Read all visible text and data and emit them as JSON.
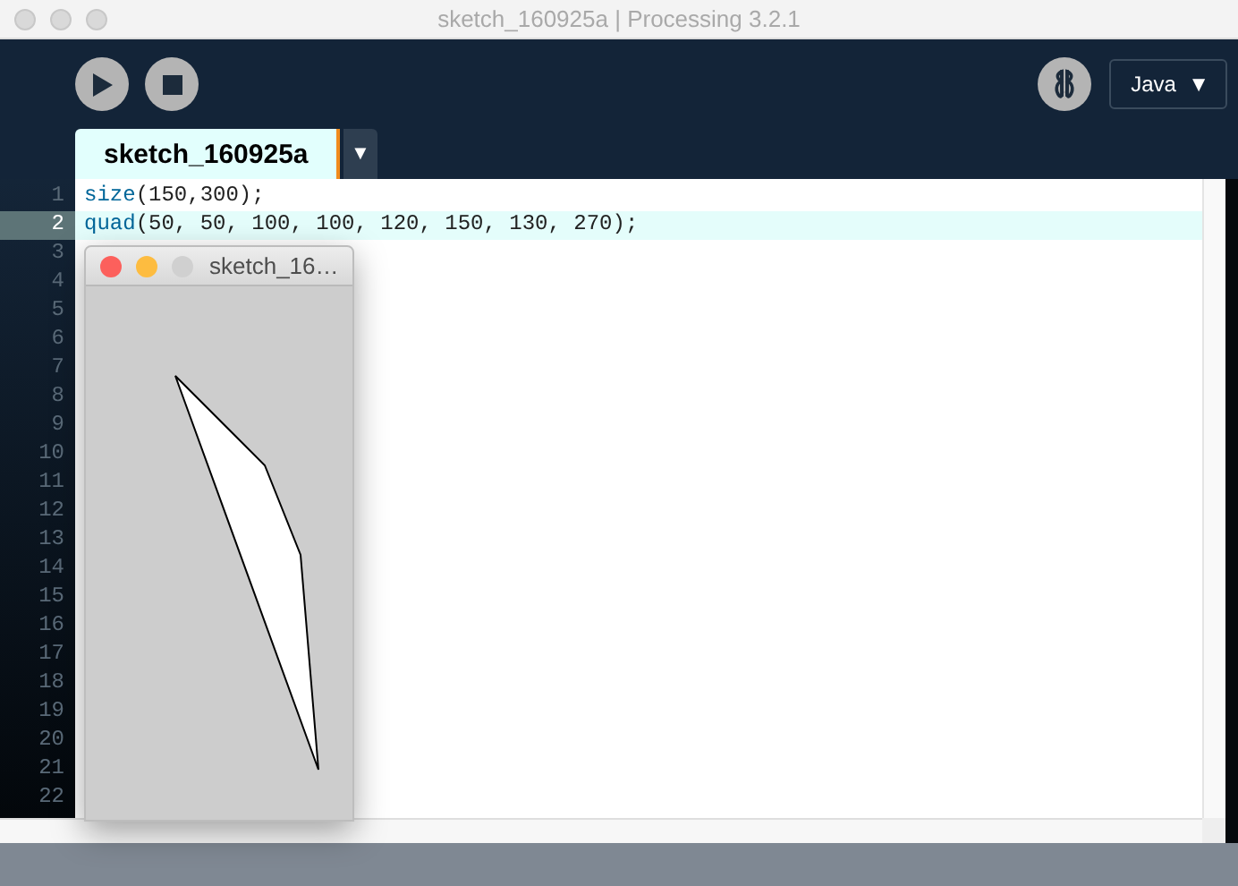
{
  "window": {
    "title": "sketch_160925a | Processing 3.2.1"
  },
  "toolbar": {
    "mode": "Java",
    "mode_caret": "▼"
  },
  "tabs": [
    {
      "label": "sketch_160925a",
      "selected": true
    }
  ],
  "tab_menu": "▼",
  "editor": {
    "lines": [
      {
        "number": "1",
        "current": false,
        "tokens": [
          {
            "kind": "function",
            "text": "size"
          },
          {
            "kind": "plain",
            "text": "(150,300);"
          }
        ]
      },
      {
        "number": "2",
        "current": true,
        "tokens": [
          {
            "kind": "function",
            "text": "quad"
          },
          {
            "kind": "plain",
            "text": "(50, 50, 100, 100, 120, 150, 130, 270);"
          }
        ]
      },
      {
        "number": "3",
        "current": false
      },
      {
        "number": "4",
        "current": false
      },
      {
        "number": "5",
        "current": false
      },
      {
        "number": "6",
        "current": false
      },
      {
        "number": "7",
        "current": false
      },
      {
        "number": "8",
        "current": false
      },
      {
        "number": "9",
        "current": false
      },
      {
        "number": "10",
        "current": false
      },
      {
        "number": "11",
        "current": false
      },
      {
        "number": "12",
        "current": false
      },
      {
        "number": "13",
        "current": false
      },
      {
        "number": "14",
        "current": false
      },
      {
        "number": "15",
        "current": false
      },
      {
        "number": "16",
        "current": false
      },
      {
        "number": "17",
        "current": false
      },
      {
        "number": "18",
        "current": false
      },
      {
        "number": "19",
        "current": false
      },
      {
        "number": "20",
        "current": false
      },
      {
        "number": "21",
        "current": false
      },
      {
        "number": "22",
        "current": false
      }
    ]
  },
  "sketch_window": {
    "title": "sketch_16…"
  }
}
